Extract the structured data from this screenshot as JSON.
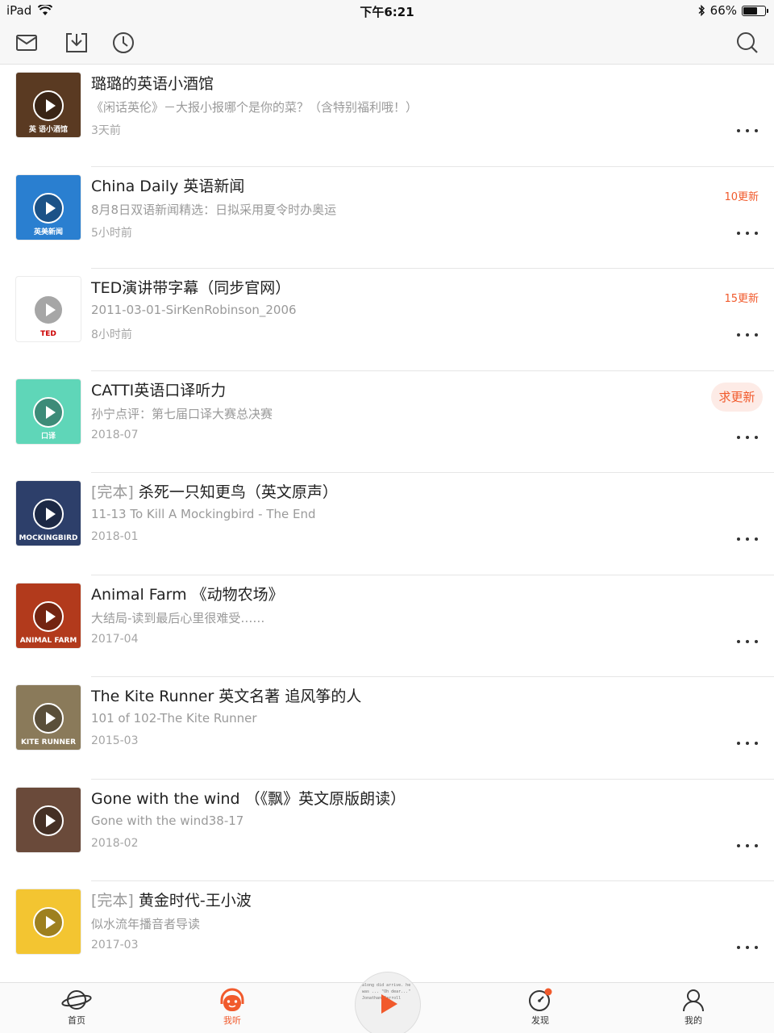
{
  "status_bar": {
    "device": "iPad",
    "time": "下午6:21",
    "battery": "66%",
    "battery_level": 0.66
  },
  "toolbar": {
    "icons": [
      "mail-icon",
      "download-icon",
      "history-icon",
      "search-icon"
    ]
  },
  "colors": {
    "accent": "#f15a2c",
    "text": "#222222",
    "muted": "#9a9a9a"
  },
  "items": [
    {
      "prefix": "",
      "title": "璐璐的英语小酒馆",
      "subtitle": "《闲话英伦》－大报小报哪个是你的菜？（含特别福利哦！）",
      "time": "3天前",
      "badge": "",
      "action": "",
      "thumb_bg": "#5a3a22",
      "thumb_text": "英 语小酒馆"
    },
    {
      "prefix": "",
      "title": "China Daily 英语新闻",
      "subtitle": "8月8日双语新闻精选：日拟采用夏令时办奥运",
      "time": "5小时前",
      "badge": "10更新",
      "action": "",
      "thumb_bg": "#2a7fd0",
      "thumb_text": "英美新闻"
    },
    {
      "prefix": "",
      "title": "TED演讲带字幕（同步官网）",
      "subtitle": "2011-03-01-SirKenRobinson_2006",
      "time": "8小时前",
      "badge": "15更新",
      "action": "",
      "thumb_bg": "#ffffff",
      "thumb_text": "TED"
    },
    {
      "prefix": "",
      "title": "CATTI英语口译听力",
      "subtitle": "孙宁点评：第七届口译大赛总决赛",
      "time": "2018-07",
      "badge": "",
      "action": "求更新",
      "thumb_bg": "#5fd6b8",
      "thumb_text": "口译"
    },
    {
      "prefix": "[完本]",
      "title": "杀死一只知更鸟（英文原声）",
      "subtitle": "11-13 To Kill A Mockingbird - The End",
      "time": "2018-01",
      "badge": "",
      "action": "",
      "thumb_bg": "#2d3f6a",
      "thumb_text": "MOCKINGBIRD"
    },
    {
      "prefix": "",
      "title": "Animal Farm 《动物农场》",
      "subtitle": "大结局-读到最后心里很难受……",
      "time": "2017-04",
      "badge": "",
      "action": "",
      "thumb_bg": "#b23a1c",
      "thumb_text": "ANIMAL FARM"
    },
    {
      "prefix": "",
      "title": "The Kite Runner 英文名著 追风筝的人",
      "subtitle": "101 of 102-The Kite Runner",
      "time": "2015-03",
      "badge": "",
      "action": "",
      "thumb_bg": "#8a7a5a",
      "thumb_text": "KITE RUNNER"
    },
    {
      "prefix": "",
      "title": "Gone with the wind （《飘》英文原版朗读）",
      "subtitle": "Gone with the wind38-17",
      "time": "2018-02",
      "badge": "",
      "action": "",
      "thumb_bg": "#6a4a3a",
      "thumb_text": ""
    },
    {
      "prefix": "[完本]",
      "title": "黄金时代-王小波",
      "subtitle": "似水流年播音者导读",
      "time": "2017-03",
      "badge": "",
      "action": "",
      "thumb_bg": "#f3c531",
      "thumb_text": ""
    }
  ],
  "tabs": [
    {
      "label": "首页",
      "icon": "planet-icon",
      "active": false
    },
    {
      "label": "我听",
      "icon": "headphones-icon",
      "active": true
    },
    {
      "label": "",
      "icon": "play-disc-icon",
      "active": false,
      "disc_text": "along did arrive. he was ... \"Oh dear...\" Jonathan Carroll"
    },
    {
      "label": "发现",
      "icon": "compass-icon",
      "active": false
    },
    {
      "label": "我的",
      "icon": "person-icon",
      "active": false
    }
  ]
}
